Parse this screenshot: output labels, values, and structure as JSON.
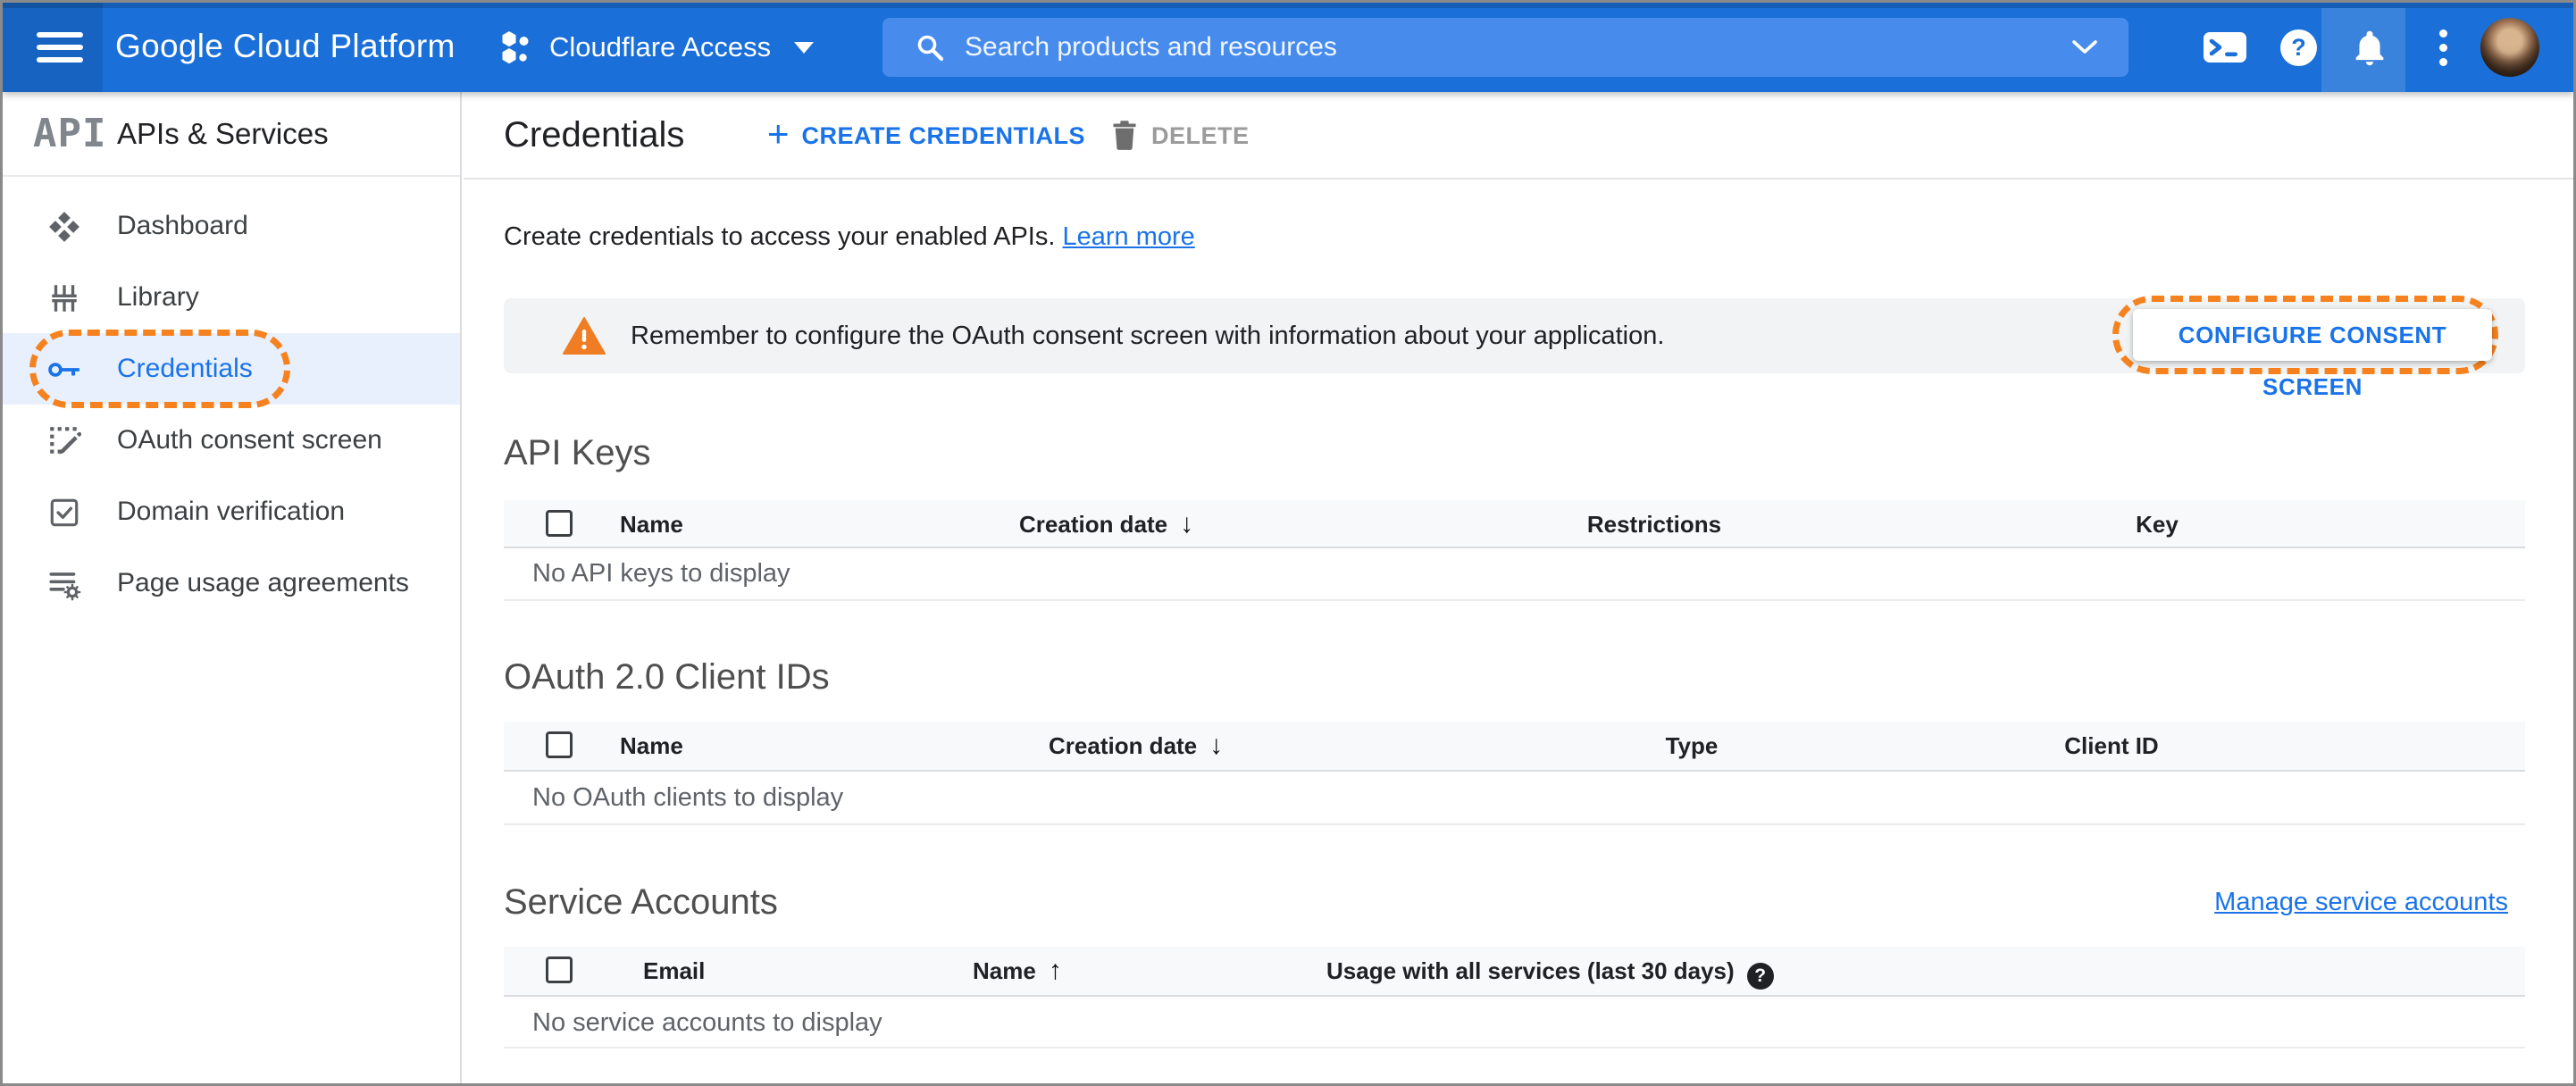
{
  "header": {
    "logo_text": "Google Cloud Platform",
    "project_name": "Cloudflare Access",
    "search_placeholder": "Search products and resources"
  },
  "icons": {
    "plus": "+",
    "question_mark": "?",
    "sort_desc": "↓",
    "sort_asc": "↑",
    "api_logo": "API"
  },
  "sidebar": {
    "product_title": "APIs & Services",
    "items": [
      {
        "label": "Dashboard",
        "icon": "dashboard-icon",
        "active": false
      },
      {
        "label": "Library",
        "icon": "library-icon",
        "active": false
      },
      {
        "label": "Credentials",
        "icon": "key-icon",
        "active": true
      },
      {
        "label": "OAuth consent screen",
        "icon": "oauth-consent-icon",
        "active": false
      },
      {
        "label": "Domain verification",
        "icon": "domain-verification-icon",
        "active": false
      },
      {
        "label": "Page usage agreements",
        "icon": "page-usage-agreements-icon",
        "active": false
      }
    ]
  },
  "toolbar": {
    "title": "Credentials",
    "create_label": "CREATE CREDENTIALS",
    "delete_label": "DELETE"
  },
  "intro": {
    "text": "Create credentials to access your enabled APIs.",
    "link_label": "Learn more"
  },
  "banner": {
    "message": "Remember to configure the OAuth consent screen with information about your application.",
    "button_label": "CONFIGURE CONSENT SCREEN"
  },
  "sections": {
    "api_keys": {
      "title": "API Keys",
      "columns": [
        "Name",
        "Creation date",
        "Restrictions",
        "Key"
      ],
      "empty_message": "No API keys to display"
    },
    "oauth_clients": {
      "title": "OAuth 2.0 Client IDs",
      "columns": [
        "Name",
        "Creation date",
        "Type",
        "Client ID"
      ],
      "empty_message": "No OAuth clients to display"
    },
    "service_accounts": {
      "title": "Service Accounts",
      "manage_link_label": "Manage service accounts",
      "columns": [
        "Email",
        "Name",
        "Usage with all services (last 30 days)"
      ],
      "empty_message": "No service accounts to display"
    }
  },
  "colors": {
    "accent_blue": "#1a73e8",
    "header_blue": "#1a6fd8",
    "annotation_orange": "#f5821f",
    "warning_orange": "#f07d23",
    "banner_gray": "#f1f3f4",
    "active_item_bg": "#e8f0fe"
  }
}
